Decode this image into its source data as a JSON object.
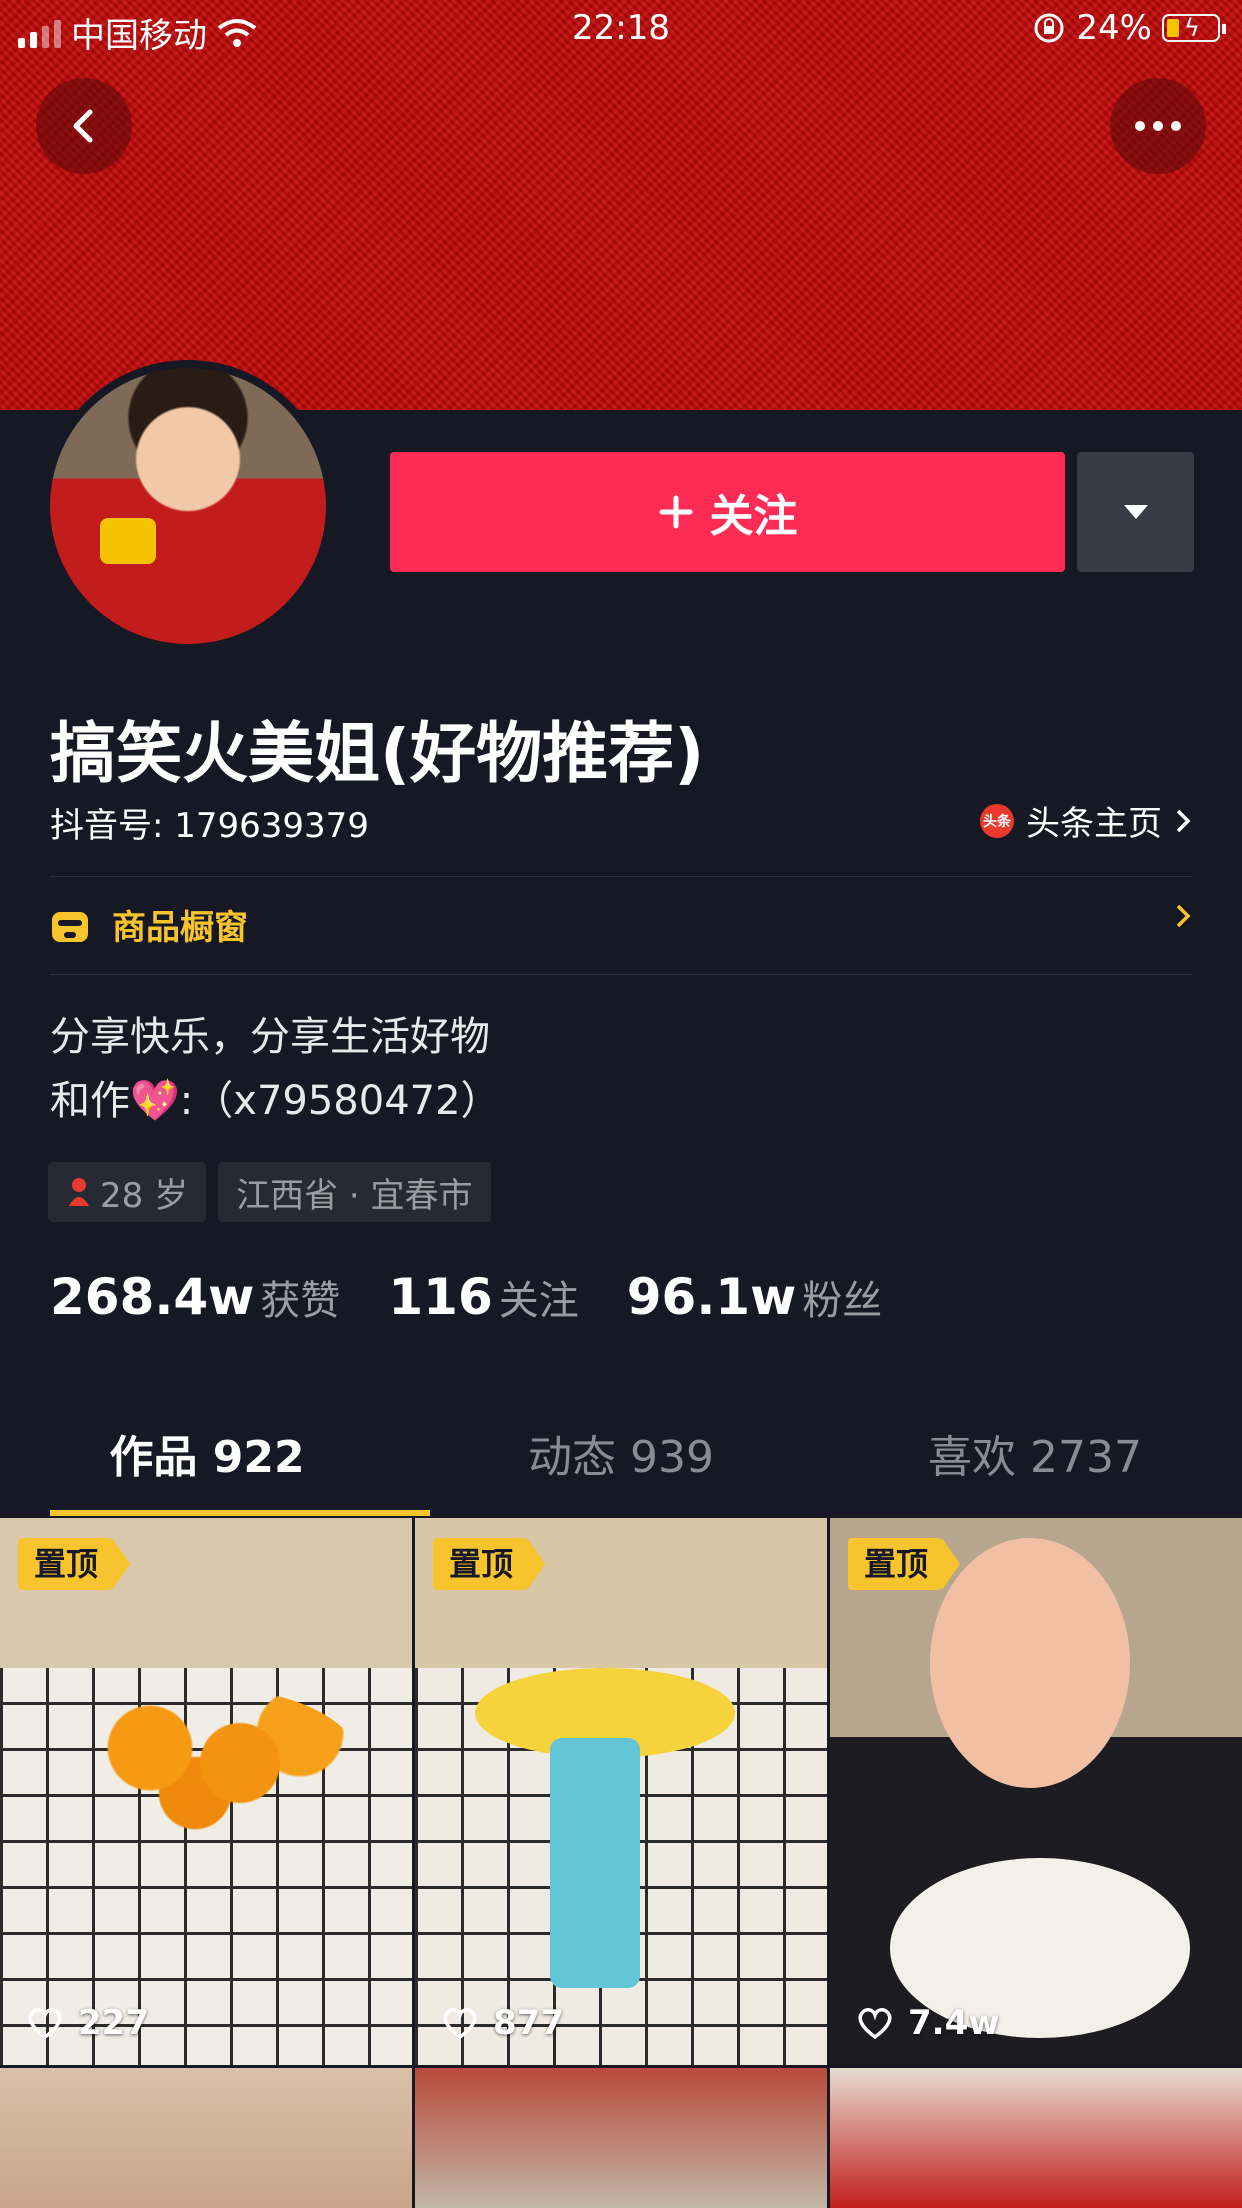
{
  "status_bar": {
    "carrier": "中国移动",
    "time": "22:18",
    "battery": "24%"
  },
  "profile": {
    "follow_label": "关注",
    "name": "搞笑火美姐(好物推荐)",
    "douyin_id": "抖音号: 179639379",
    "toutiao_icon_text": "头条",
    "toutiao_link": "头条主页",
    "shop_label": "商品橱窗",
    "bio_line1": "分享快乐，分享生活好物",
    "bio_line2": "和作💖:（x79580472）",
    "tag_age": "28 岁",
    "tag_location": "江西省 · 宜春市"
  },
  "stats": [
    {
      "num": "268.4w",
      "label": "获赞"
    },
    {
      "num": "116",
      "label": "关注"
    },
    {
      "num": "96.1w",
      "label": "粉丝"
    }
  ],
  "tabs": [
    "作品 922",
    "动态 939",
    "喜欢 2737"
  ],
  "videos": [
    {
      "pin": "置顶",
      "likes": "227"
    },
    {
      "pin": "置顶",
      "likes": "877"
    },
    {
      "pin": "置顶",
      "likes": "7.4w"
    }
  ],
  "colors": {
    "accent": "#fe2c55",
    "gold": "#f7c42d",
    "bg": "#161823"
  }
}
